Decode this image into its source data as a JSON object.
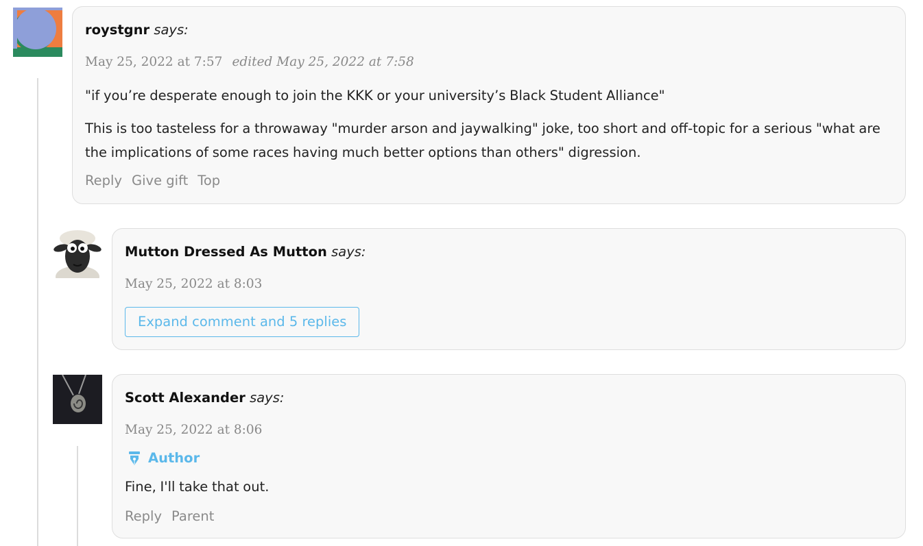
{
  "comments": [
    {
      "author": "roystgnr",
      "says": "says:",
      "date": "May 25, 2022 at 7:57",
      "edited": "edited May 25, 2022 at 7:58",
      "paragraphs": [
        "\"if you’re desperate enough to join the KKK or your university’s Black Student Alliance\"",
        "This is too tasteless for a throwaway \"murder arson and jaywalking\" joke, too short and off-topic for a serious \"what are the implications of some races having much better options than others\" digression."
      ],
      "actions": [
        "Reply",
        "Give gift",
        "Top"
      ],
      "avatar_icon": "abstract-circle-avatar-icon",
      "avatar_colors": [
        "#8e9fd9",
        "#ee7d40",
        "#2b8a5e"
      ]
    },
    {
      "author": "Mutton Dressed As Mutton",
      "says": "says:",
      "date": "May 25, 2022 at 8:03",
      "expand_label": "Expand comment and 5 replies",
      "avatar_icon": "sheep-avatar-icon"
    },
    {
      "author": "Scott Alexander",
      "says": "says:",
      "date": "May 25, 2022 at 8:06",
      "badge": "Author",
      "badge_icon": "pen-nib-icon",
      "paragraphs": [
        "Fine, I'll take that out."
      ],
      "actions": [
        "Reply",
        "Parent"
      ],
      "avatar_icon": "pendant-avatar-icon"
    }
  ],
  "colors": {
    "accent": "#5bb8ea",
    "card_bg": "#f8f8f8",
    "card_border": "#dedede",
    "muted_text": "#888888",
    "thread_line": "#dcdcdc"
  }
}
